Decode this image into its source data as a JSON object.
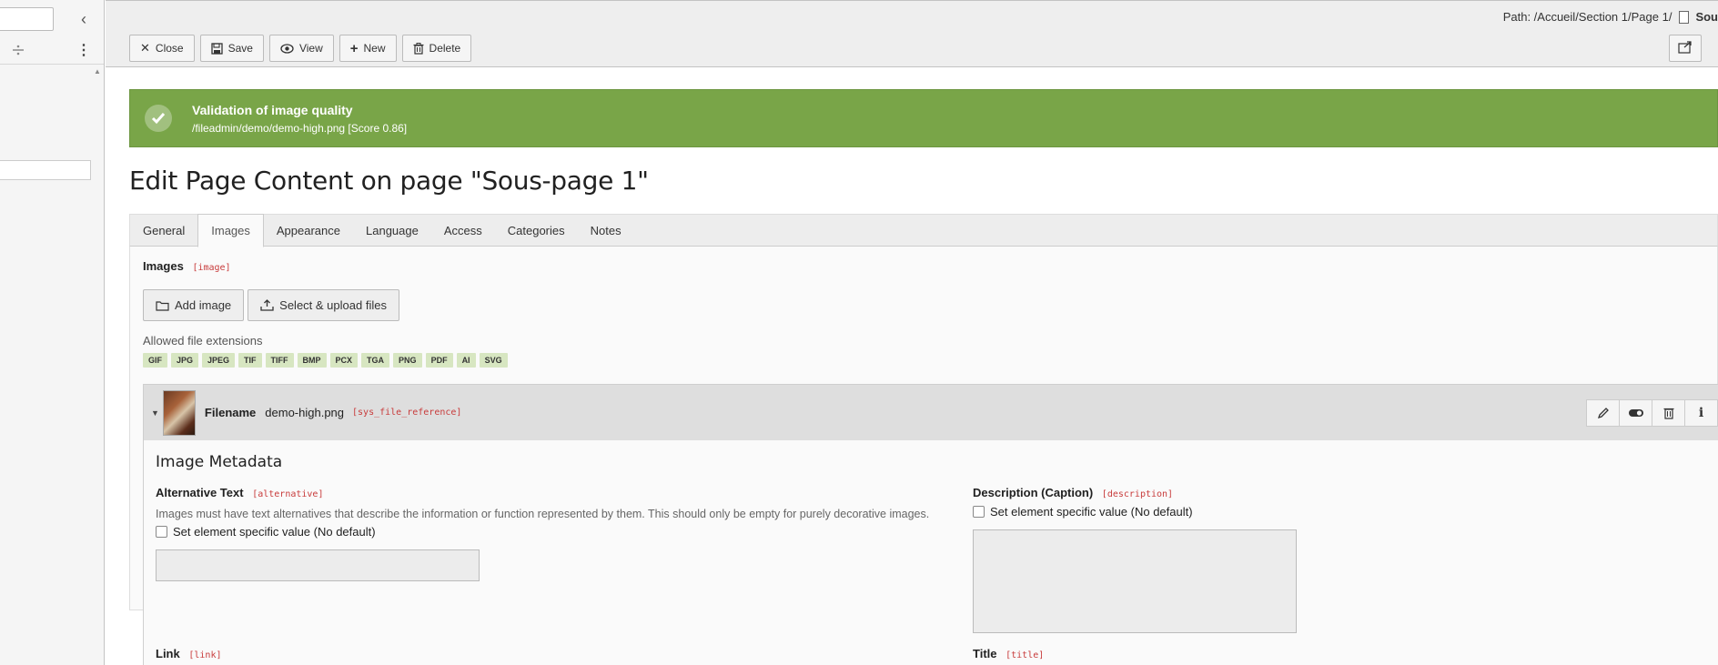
{
  "tree": {
    "collapse_icon": "chevron-left-icon",
    "filter_icon": "filter-icon",
    "menu_icon": "ellipsis-vertical-icon"
  },
  "header": {
    "path_label": "Path: /Accueil/Section 1/Page 1/",
    "path_current": "Sou"
  },
  "toolbar": {
    "close_label": "Close",
    "save_label": "Save",
    "view_label": "View",
    "new_label": "New",
    "delete_label": "Delete"
  },
  "alert": {
    "title": "Validation of image quality",
    "message": "/fileadmin/demo/demo-high.png [Score 0.86]",
    "color": "#79a548"
  },
  "page_title": "Edit Page Content on page \"Sous-page 1\"",
  "tabs": [
    {
      "label": "General",
      "active": false
    },
    {
      "label": "Images",
      "active": true
    },
    {
      "label": "Appearance",
      "active": false
    },
    {
      "label": "Language",
      "active": false
    },
    {
      "label": "Access",
      "active": false
    },
    {
      "label": "Categories",
      "active": false
    },
    {
      "label": "Notes",
      "active": false
    }
  ],
  "images_field": {
    "label": "Images",
    "key": "[image]",
    "add_image_label": "Add image",
    "upload_label": "Select & upload files",
    "allowed_label": "Allowed file extensions",
    "extensions": [
      "GIF",
      "JPG",
      "JPEG",
      "TIF",
      "TIFF",
      "BMP",
      "PCX",
      "TGA",
      "PNG",
      "PDF",
      "AI",
      "SVG"
    ]
  },
  "reference": {
    "filename_label": "Filename",
    "filename": "demo-high.png",
    "key": "[sys_file_reference]",
    "metadata_title": "Image Metadata",
    "alternative": {
      "label": "Alternative Text",
      "key": "[alternative]",
      "help": "Images must have text alternatives that describe the information or function represented by them. This should only be empty for purely decorative images.",
      "checkbox_label": "Set element specific value (No default)"
    },
    "description": {
      "label": "Description (Caption)",
      "key": "[description]",
      "checkbox_label": "Set element specific value (No default)"
    },
    "link": {
      "label": "Link",
      "key": "[link]"
    },
    "title": {
      "label": "Title",
      "key": "[title]"
    }
  }
}
